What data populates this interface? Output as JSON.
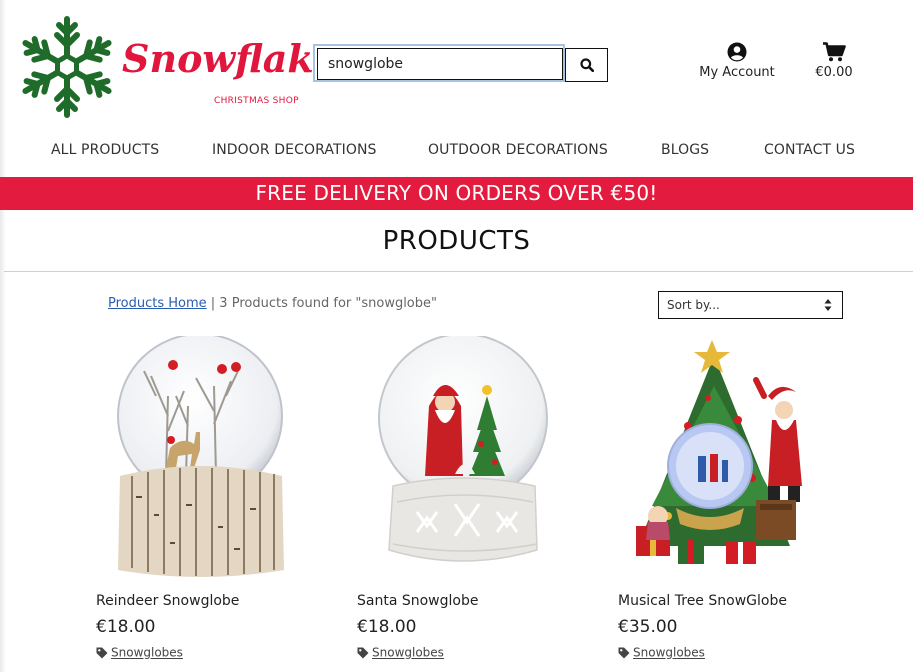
{
  "brand": {
    "name": "Snowflakes",
    "subtitle": "CHRISTMAS SHOP",
    "color": "#e0163d",
    "flake_color": "#1f6b2a"
  },
  "search": {
    "value": "snowglobe",
    "button_icon": "search-icon"
  },
  "header": {
    "account": {
      "label": "My Account",
      "icon": "user-circle-icon"
    },
    "cart": {
      "total": "€0.00",
      "icon": "cart-icon"
    }
  },
  "nav": {
    "items": [
      {
        "label": "ALL PRODUCTS"
      },
      {
        "label": "INDOOR DECORATIONS"
      },
      {
        "label": "OUTDOOR DECORATIONS"
      },
      {
        "label": "BLOGS"
      },
      {
        "label": "CONTACT US"
      }
    ]
  },
  "banner": {
    "text": "FREE DELIVERY ON ORDERS OVER €50!",
    "color": "#e31b3f"
  },
  "page": {
    "title": "PRODUCTS",
    "breadcrumb_link": "Products Home",
    "result_text": " | 3 Products found for \"snowglobe\""
  },
  "sort": {
    "selected": "Sort by..."
  },
  "products": [
    {
      "name": "Reindeer Snowglobe",
      "price": "€18.00",
      "category": "Snowglobes"
    },
    {
      "name": "Santa Snowglobe",
      "price": "€18.00",
      "category": "Snowglobes"
    },
    {
      "name": "Musical Tree SnowGlobe",
      "price": "€35.00",
      "category": "Snowglobes"
    }
  ]
}
